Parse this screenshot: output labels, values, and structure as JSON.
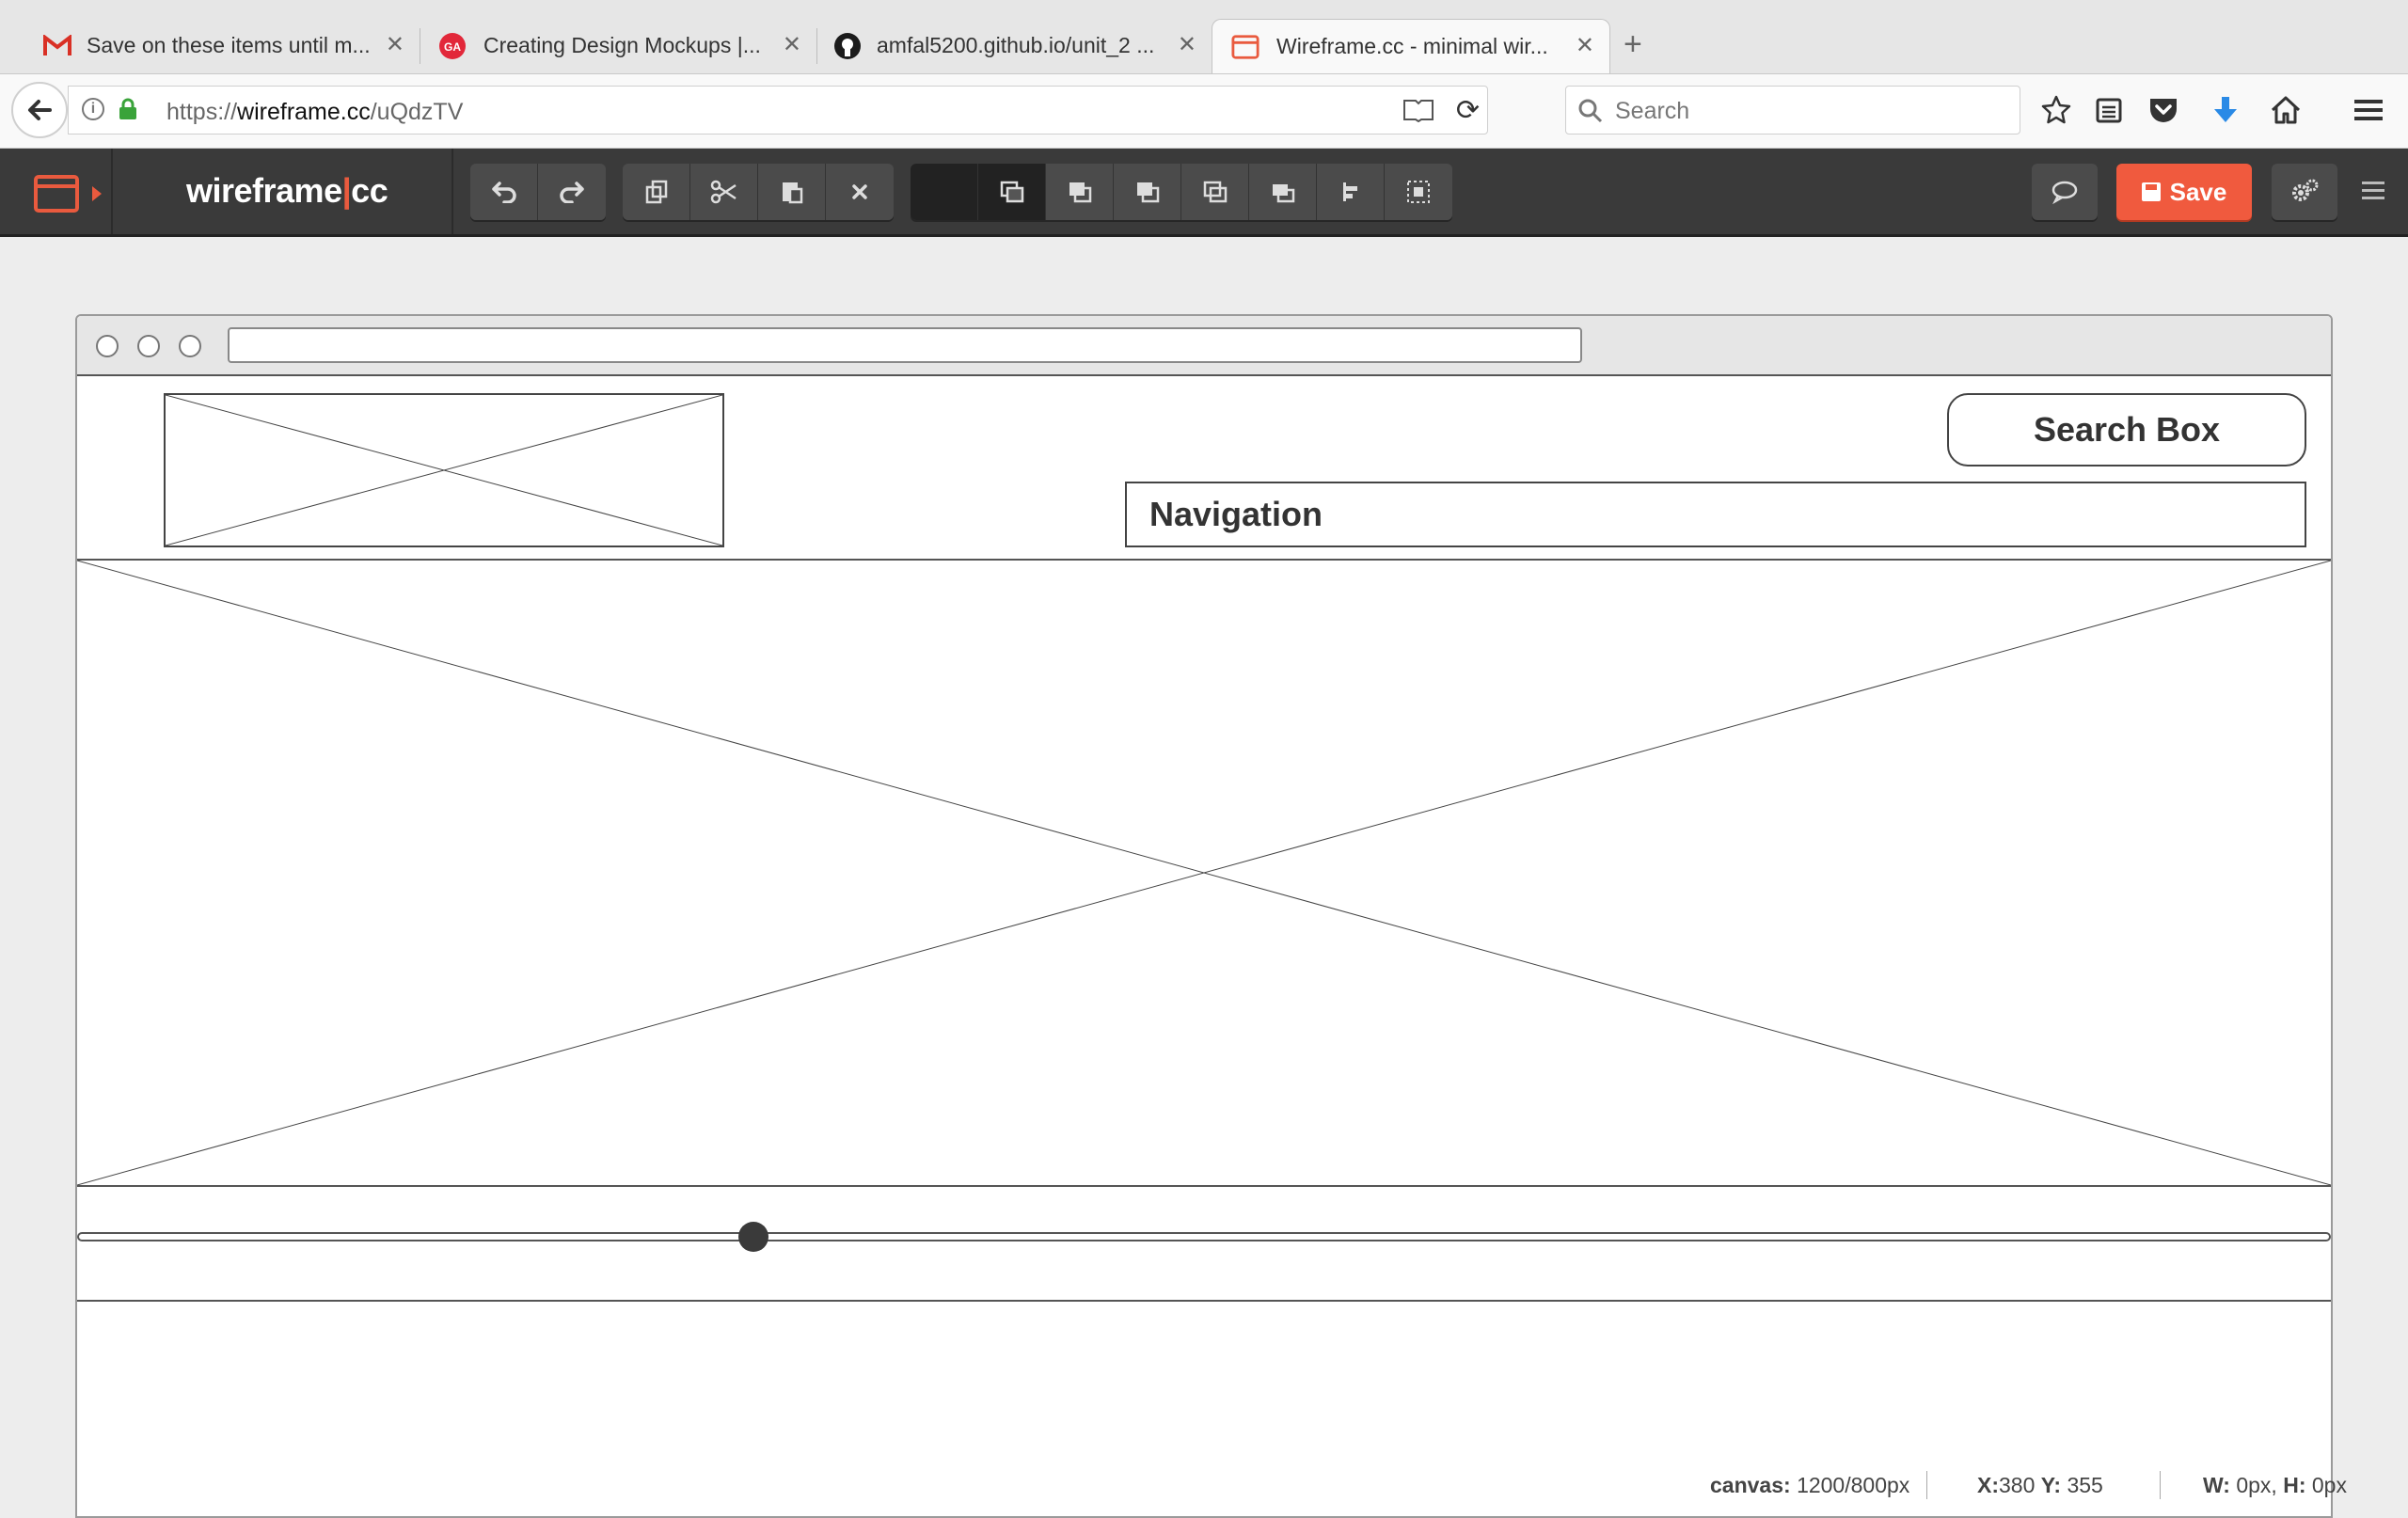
{
  "browser": {
    "tabs": [
      {
        "title": "Save on these items until m...",
        "icon": "gmail-icon"
      },
      {
        "title": "Creating Design Mockups |...",
        "icon": "ga-icon"
      },
      {
        "title": "amfal5200.github.io/unit_2 ...",
        "icon": "github-icon"
      },
      {
        "title": "Wireframe.cc - minimal wir...",
        "icon": "wireframe-icon",
        "active": true
      }
    ],
    "url_prefix": "https://",
    "url_host": "wireframe.cc",
    "url_path": "/uQdzTV",
    "search_placeholder": "Search"
  },
  "app": {
    "brand_left": "wireframe",
    "brand_bar": "|",
    "brand_right": "cc",
    "save_label": "Save",
    "accent_color": "#f05a3e"
  },
  "wireframe": {
    "search_box_label": "Search Box",
    "navigation_label": "Navigation",
    "slider_value": 0.3
  },
  "status": {
    "canvas_label": "canvas:",
    "canvas_value": "1200/800px",
    "x_label": "X:",
    "x_value": "380",
    "y_label": "Y:",
    "y_value": "355",
    "w_label": "W:",
    "w_value": "0px,",
    "h_label": "H:",
    "h_value": "0px"
  }
}
